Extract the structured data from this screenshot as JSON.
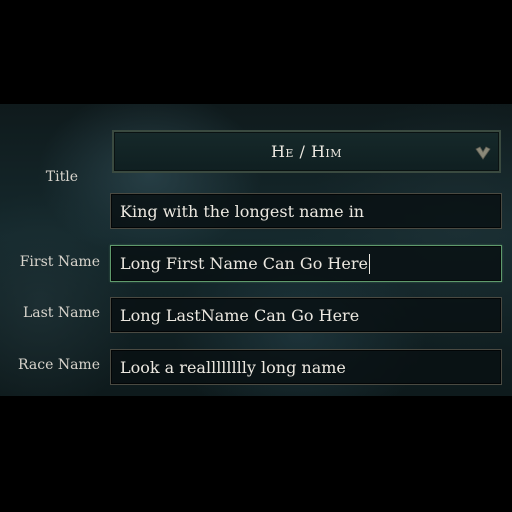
{
  "form": {
    "title": {
      "label": "Title",
      "pronoun": "He / Him",
      "value": "King with the longest name in"
    },
    "first_name": {
      "label": "First Name",
      "value": "Long First Name Can Go Here"
    },
    "last_name": {
      "label": "Last Name",
      "value": "Long LastName Can Go Here"
    },
    "race_name": {
      "label": "Race Name",
      "value": "Look a realllllllly long name"
    }
  },
  "colors": {
    "active_border": "#5f9a6c",
    "field_border": "#4a4a42",
    "text": "#ece8e0",
    "label": "#d8d4cc"
  },
  "icons": {
    "dropdown": "chevron-down-icon"
  }
}
